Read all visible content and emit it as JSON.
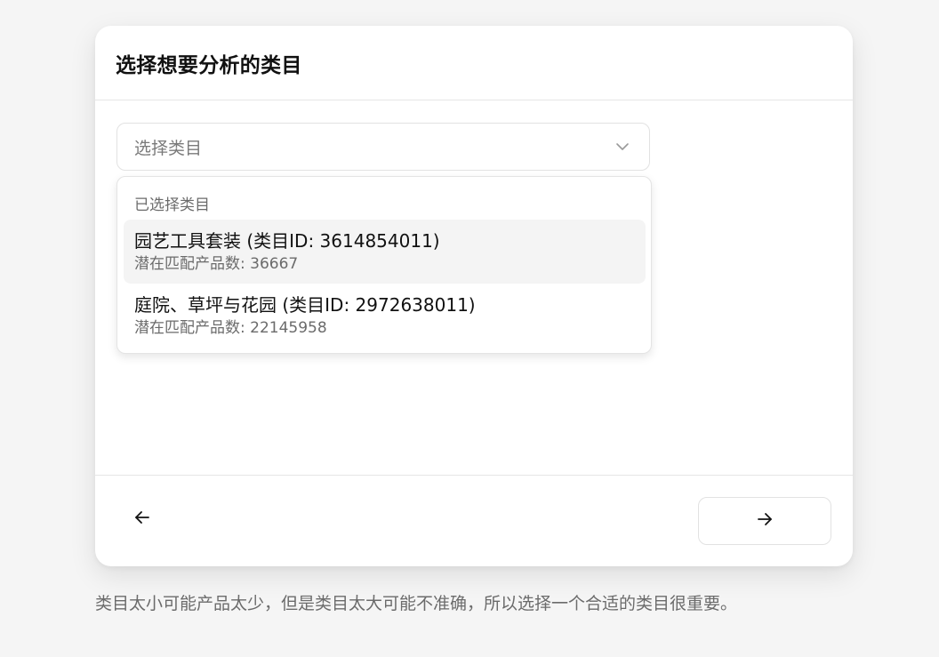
{
  "card": {
    "title": "选择想要分析的类目"
  },
  "select": {
    "placeholder": "选择类目",
    "icon": "chevron-down-icon"
  },
  "dropdown": {
    "heading": "已选择类目",
    "options": [
      {
        "name": "园艺工具套装 (类目ID: 3614854011)",
        "subtitle": "潜在匹配产品数: 36667",
        "highlighted": true
      },
      {
        "name": "庭院、草坪与花园 (类目ID: 2972638011)",
        "subtitle": "潜在匹配产品数: 22145958",
        "highlighted": false
      }
    ]
  },
  "footer": {
    "back_icon": "arrow-left-icon",
    "next_icon": "arrow-right-icon"
  },
  "hint": "类目太小可能产品太少，但是类目太大可能不准确，所以选择一个合适的类目很重要。",
  "colors": {
    "background": "#f5f5f5",
    "card": "#ffffff",
    "highlight": "#f4f4f4",
    "muted_text": "#6b6b6b",
    "border": "#e2e2e2"
  }
}
